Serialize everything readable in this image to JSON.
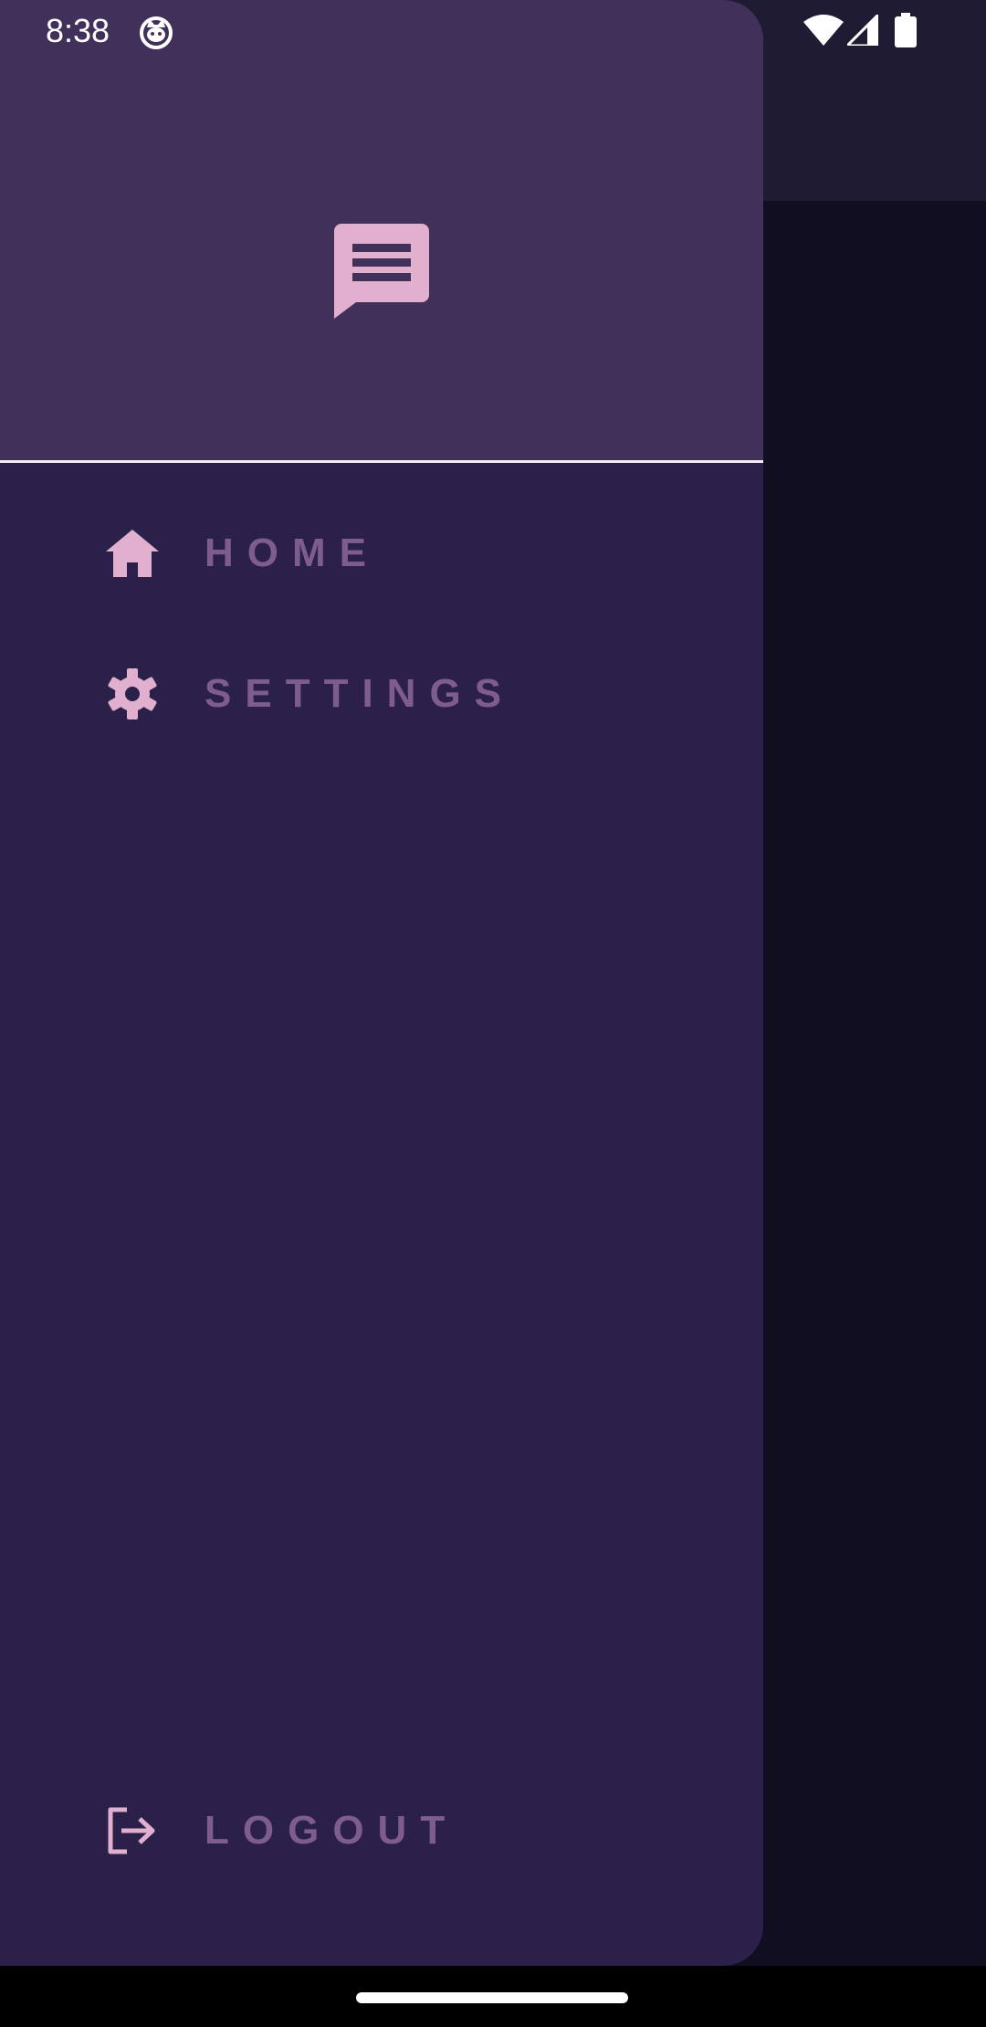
{
  "status_bar": {
    "time": "8:38",
    "notification_icon": "cat-icon",
    "wifi_icon": "wifi-icon",
    "signal_icon": "cell-signal-icon",
    "battery_icon": "battery-icon"
  },
  "drawer": {
    "header_icon": "chat-message-icon",
    "items": [
      {
        "label": "HOME",
        "icon": "home-icon"
      },
      {
        "label": "SETTINGS",
        "icon": "gear-icon"
      }
    ],
    "footer_item": {
      "label": "LOGOUT",
      "icon": "logout-icon"
    }
  },
  "colors": {
    "drawer_bg": "#2b2049",
    "header_bg": "#40305a",
    "icon_pink": "#e2b0cf",
    "label_muted": "#7e5d8e",
    "scrim_bg": "#120e22"
  }
}
